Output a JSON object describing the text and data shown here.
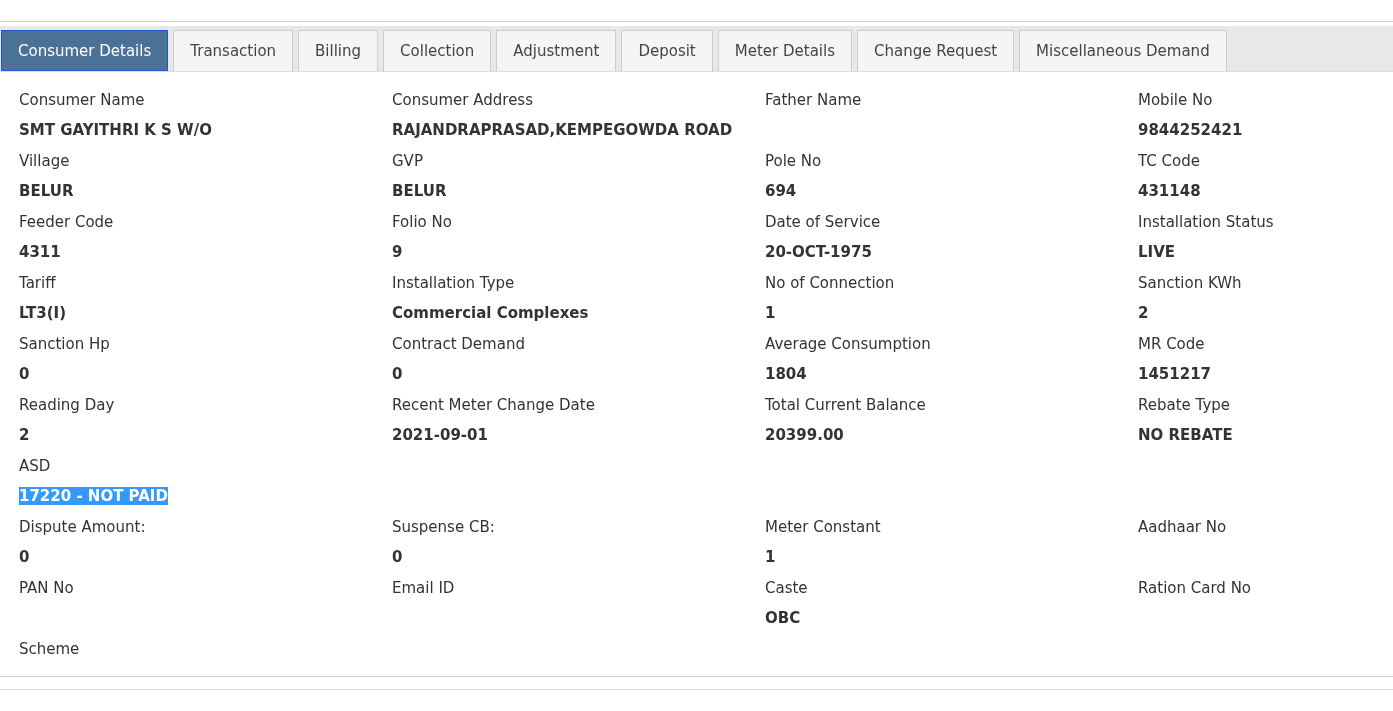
{
  "tabs": [
    {
      "label": "Consumer Details",
      "selected": true
    },
    {
      "label": "Transaction",
      "selected": false
    },
    {
      "label": "Billing",
      "selected": false
    },
    {
      "label": "Collection",
      "selected": false
    },
    {
      "label": "Adjustment",
      "selected": false
    },
    {
      "label": "Deposit",
      "selected": false
    },
    {
      "label": "Meter Details",
      "selected": false
    },
    {
      "label": "Change Request",
      "selected": false
    },
    {
      "label": "Miscellaneous Demand",
      "selected": false
    }
  ],
  "rows": [
    [
      {
        "label": "Consumer Name",
        "value": "SMT GAYITHRI K S W/O"
      },
      {
        "label": "Consumer Address",
        "value": "RAJANDRAPRASAD,KEMPEGOWDA ROAD"
      },
      {
        "label": "Father Name"
      },
      {
        "label": "Mobile No",
        "value": "9844252421"
      }
    ],
    [
      {
        "label": "Village",
        "value": "BELUR"
      },
      {
        "label": "GVP",
        "value": "BELUR"
      },
      {
        "label": "Pole No",
        "value": "694"
      },
      {
        "label": "TC Code",
        "value": "431148"
      }
    ],
    [
      {
        "label": "Feeder Code",
        "value": "4311"
      },
      {
        "label": "Folio No",
        "value": "9"
      },
      {
        "label": "Date of Service",
        "value": "20-OCT-1975"
      },
      {
        "label": "Installation Status",
        "value": "LIVE"
      }
    ],
    [
      {
        "label": "Tariff",
        "value": "LT3(I)"
      },
      {
        "label": "Installation Type",
        "value": "Commercial Complexes"
      },
      {
        "label": "No of Connection",
        "value": "1"
      },
      {
        "label": "Sanction KWh",
        "value": "2"
      }
    ],
    [
      {
        "label": "Sanction Hp",
        "value": "0"
      },
      {
        "label": "Contract Demand",
        "value": "0"
      },
      {
        "label": "Average Consumption",
        "value": "1804"
      },
      {
        "label": "MR Code",
        "value": "1451217"
      }
    ],
    [
      {
        "label": "Reading Day",
        "value": "2"
      },
      {
        "label": "Recent Meter Change Date",
        "value": "2021-09-01"
      },
      {
        "label": "Total Current Balance",
        "value": "20399.00"
      },
      {
        "label": "Rebate Type",
        "value": "NO REBATE"
      }
    ],
    [
      {
        "label": "ASD",
        "value": "17220 - NOT PAID",
        "highlighted": true
      }
    ],
    [
      {
        "label": "Dispute Amount:",
        "value": "0"
      },
      {
        "label": "Suspense CB:",
        "value": "0"
      },
      {
        "label": "Meter Constant",
        "value": "1"
      },
      {
        "label": "Aadhaar No"
      }
    ],
    [
      {
        "label": "PAN No"
      },
      {
        "label": "Email ID"
      },
      {
        "label": "Caste",
        "value": "OBC"
      },
      {
        "label": "Ration Card No"
      }
    ],
    [
      {
        "label": "Scheme"
      }
    ]
  ]
}
